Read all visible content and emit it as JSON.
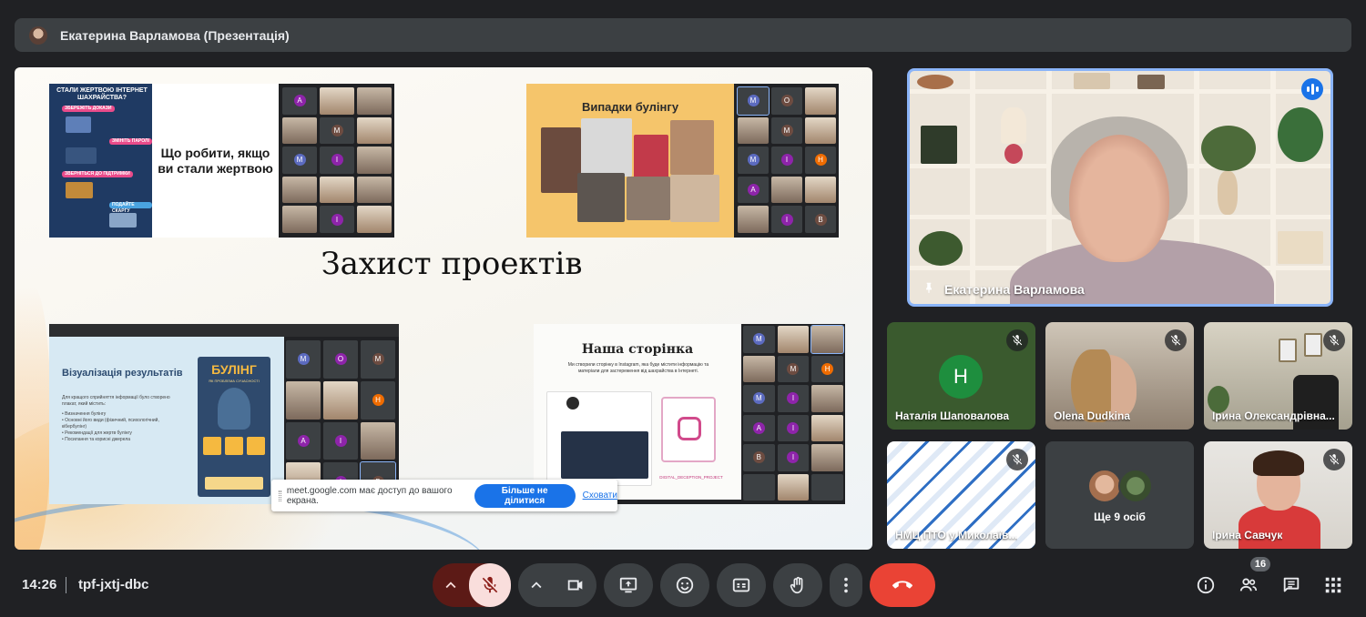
{
  "presenter_bar": {
    "title": "Екатерина Варламова (Презентація)"
  },
  "slide": {
    "heading": "Захист проектів",
    "thumb1": {
      "left_title": "СТАЛИ ЖЕРТВОЮ ІНТЕРНЕТ ШАХРАЙСТВА?",
      "pill1": "ЗБЕРЕЖІТЬ ДОКАЗИ",
      "pill2": "ЗМІНІТЬ ПАРОЛІ",
      "pill3": "ЗВЕРНІТЬСЯ ДО ПІДТРИМКИ",
      "pill4": "ПОДАЙТЕ СКАРГУ",
      "main_text": "Що робити, якщо ви стали жертвою",
      "cells": [
        "A",
        "",
        "",
        "",
        "M",
        "",
        "M",
        "I",
        "",
        "",
        "",
        "",
        "",
        "I",
        ""
      ]
    },
    "thumb2": {
      "title": "Випадки булінгу",
      "cells": [
        "M",
        "O",
        "",
        "",
        "M",
        "",
        "M",
        "I",
        "H",
        "A",
        "",
        "",
        "",
        "I",
        "B"
      ]
    },
    "thumb3": {
      "title": "Візуалізація результатів",
      "intro": "Для кращого сприйняття інформації було створено плакат, який містить:",
      "bullets": [
        "Визначення булінгу",
        "Основні його види (фізичний, психологічний, кібербулінг)",
        "Рекомендації для жертв булінгу",
        "Посилання та корисні джерела"
      ],
      "poster_title": "БУЛІНГ",
      "poster_sub": "ЯК ПРОБЛЕМА СУЧАСНОСТІ",
      "cells": [
        "M",
        "O",
        "M",
        "",
        "",
        "H",
        "A",
        "I",
        "",
        "",
        "I",
        "B"
      ]
    },
    "thumb4": {
      "title": "Наша сторінка",
      "text": "Ми створили сторінку в Instagram, яка буде містити інформацію та матеріали для застереження від шахрайства в Інтернеті.",
      "qr_label": "DIGITAL_DECEPTION_PROJECT",
      "cells": [
        "M",
        "",
        "",
        "",
        "M",
        "H",
        "M",
        "I",
        "",
        "A",
        "I",
        "",
        "B",
        "I",
        "",
        "",
        "",
        ""
      ]
    }
  },
  "share_toast": {
    "message": "meet.google.com має доступ до вашого екрана.",
    "stop_label": "Більше не ділитися",
    "hide_label": "Сховати"
  },
  "speaker": {
    "name": "Екатерина Варламова"
  },
  "participants": [
    {
      "name": "Наталія Шаповалова",
      "initial": "Н"
    },
    {
      "name": "Olena Dudkina"
    },
    {
      "name": "Ірина Олександрівна..."
    },
    {
      "name": "НМЦ ПТО у Миколаїв..."
    },
    {
      "name": "Ще 9 осіб"
    },
    {
      "name": "Ірина Савчук"
    }
  ],
  "bottom_bar": {
    "time": "14:26",
    "meeting_code": "tpf-jxtj-dbc",
    "people_count": "16"
  },
  "colors": {
    "end_call": "#ea4335",
    "mic_off_bg": "#f9dedc",
    "mic_off_icon": "#8c1d18",
    "accent": "#1a73e8",
    "speaking_border": "#8ab4f8"
  }
}
